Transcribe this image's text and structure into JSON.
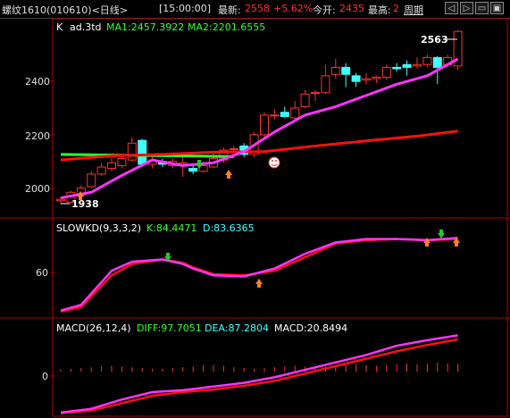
{
  "header": {
    "instrument": "螺纹1610(010610)<日线>",
    "time": "[15:00:00]",
    "latest_label": "最新:",
    "latest_value": "2558",
    "change_pct": "+5.62%",
    "open_label": "今开:",
    "open_value": "2435",
    "high_label": "最高:",
    "high_value": "2",
    "period_label": "周期",
    "buttons": [
      "◁",
      "▷",
      "▭",
      "▣"
    ]
  },
  "main_panel": {
    "label_k": "K",
    "label_ind": "ad.3td",
    "ma1_text": "MA1:2457.3922",
    "ma2_text": "MA2:2201.6555",
    "ticks": [
      "2400",
      "2200",
      "2000"
    ],
    "high_marker": "2563",
    "low_marker": "1938"
  },
  "kd_panel": {
    "name": "SLOWKD(9,3,3,2)",
    "k_text": "K:84.4471",
    "d_text": "D:83.6365",
    "ticks": [
      "60"
    ]
  },
  "macd_panel": {
    "name": "MACD(26,12,4)",
    "diff_text": "DIFF:97.7051",
    "dea_text": "DEA:87.2804",
    "macd_text": "MACD:20.8494",
    "ticks": [
      "0"
    ]
  },
  "colors": {
    "up": "#ff3030",
    "down": "#40ffff",
    "ma1": "#ff33ff",
    "ma2": "#ff1010",
    "flat_green": "#30ff30",
    "label_green": "#30ff30",
    "label_cyan": "#40ffff",
    "label_white": "#ffffff",
    "frame": "#b00000"
  },
  "chart_data": [
    {
      "type": "candlestick",
      "yticks": [
        2000,
        2200,
        2400
      ],
      "ylim": [
        1900,
        2600
      ],
      "candles": [
        {
          "o": 1955,
          "c": 1960,
          "h": 1970,
          "l": 1945
        },
        {
          "o": 1950,
          "c": 1985,
          "h": 1990,
          "l": 1945
        },
        {
          "o": 1975,
          "c": 2000,
          "h": 2010,
          "l": 1960
        },
        {
          "o": 2005,
          "c": 2050,
          "h": 2060,
          "l": 2000
        },
        {
          "o": 2050,
          "c": 2075,
          "h": 2090,
          "l": 2045
        },
        {
          "o": 2070,
          "c": 2090,
          "h": 2110,
          "l": 2060
        },
        {
          "o": 2080,
          "c": 2105,
          "h": 2120,
          "l": 2070
        },
        {
          "o": 2100,
          "c": 2160,
          "h": 2180,
          "l": 2095
        },
        {
          "o": 2170,
          "c": 2085,
          "h": 2175,
          "l": 2080
        },
        {
          "o": 2085,
          "c": 2100,
          "h": 2115,
          "l": 2070
        },
        {
          "o": 2095,
          "c": 2085,
          "h": 2105,
          "l": 2075
        },
        {
          "o": 2080,
          "c": 2095,
          "h": 2105,
          "l": 2070
        },
        {
          "o": 2085,
          "c": 2090,
          "h": 2110,
          "l": 2040
        },
        {
          "o": 2070,
          "c": 2060,
          "h": 2085,
          "l": 2050
        },
        {
          "o": 2060,
          "c": 2080,
          "h": 2095,
          "l": 2055
        },
        {
          "o": 2075,
          "c": 2105,
          "h": 2130,
          "l": 2070
        },
        {
          "o": 2100,
          "c": 2135,
          "h": 2145,
          "l": 2090
        },
        {
          "o": 2140,
          "c": 2140,
          "h": 2150,
          "l": 2130
        },
        {
          "o": 2150,
          "c": 2120,
          "h": 2160,
          "l": 2110
        },
        {
          "o": 2120,
          "c": 2190,
          "h": 2200,
          "l": 2110
        },
        {
          "o": 2190,
          "c": 2260,
          "h": 2270,
          "l": 2180
        },
        {
          "o": 2260,
          "c": 2260,
          "h": 2280,
          "l": 2245
        },
        {
          "o": 2270,
          "c": 2255,
          "h": 2290,
          "l": 2250
        },
        {
          "o": 2250,
          "c": 2285,
          "h": 2310,
          "l": 2240
        },
        {
          "o": 2290,
          "c": 2335,
          "h": 2350,
          "l": 2285
        },
        {
          "o": 2340,
          "c": 2340,
          "h": 2350,
          "l": 2310
        },
        {
          "o": 2340,
          "c": 2400,
          "h": 2440,
          "l": 2335
        },
        {
          "o": 2405,
          "c": 2430,
          "h": 2460,
          "l": 2390
        },
        {
          "o": 2430,
          "c": 2405,
          "h": 2445,
          "l": 2360
        },
        {
          "o": 2400,
          "c": 2380,
          "h": 2410,
          "l": 2360
        },
        {
          "o": 2385,
          "c": 2390,
          "h": 2410,
          "l": 2370
        },
        {
          "o": 2390,
          "c": 2395,
          "h": 2400,
          "l": 2375
        },
        {
          "o": 2395,
          "c": 2430,
          "h": 2440,
          "l": 2385
        },
        {
          "o": 2430,
          "c": 2425,
          "h": 2445,
          "l": 2415
        },
        {
          "o": 2440,
          "c": 2430,
          "h": 2455,
          "l": 2400
        },
        {
          "o": 2435,
          "c": 2440,
          "h": 2465,
          "l": 2425
        },
        {
          "o": 2440,
          "c": 2465,
          "h": 2475,
          "l": 2430
        },
        {
          "o": 2465,
          "c": 2430,
          "h": 2470,
          "l": 2370
        },
        {
          "o": 2440,
          "c": 2465,
          "h": 2475,
          "l": 2430
        },
        {
          "o": 2435,
          "c": 2558,
          "h": 2563,
          "l": 2420
        }
      ],
      "ma1_x": [
        0,
        3,
        6,
        9,
        12,
        15,
        18,
        21,
        24,
        27,
        30,
        33,
        36,
        39
      ],
      "ma1": [
        1965,
        1985,
        2045,
        2100,
        2080,
        2090,
        2130,
        2200,
        2260,
        2290,
        2330,
        2370,
        2400,
        2460
      ],
      "ma2_x": [
        0,
        5,
        10,
        15,
        20,
        25,
        30,
        35,
        39
      ],
      "ma2": [
        2100,
        2115,
        2120,
        2128,
        2130,
        2150,
        2168,
        2185,
        2203
      ]
    },
    {
      "type": "line",
      "name": "SLOWKD(9,3,3,2)",
      "yticks": [
        60
      ],
      "ylim": [
        20,
        105
      ],
      "x": [
        0,
        2,
        5,
        7,
        10,
        12,
        13,
        15,
        18,
        21,
        24,
        27,
        30,
        33,
        36,
        39
      ],
      "k": [
        25,
        30,
        60,
        68,
        70,
        66,
        62,
        56,
        55,
        62,
        75,
        85,
        88,
        88,
        87,
        89
      ],
      "d": [
        24,
        28,
        56,
        66,
        70,
        67,
        63,
        57,
        56,
        60,
        72,
        84,
        87,
        88,
        87,
        88
      ]
    },
    {
      "type": "line",
      "name": "MACD(26,12,4)",
      "yticks": [
        0
      ],
      "ylim": [
        -120,
        140
      ],
      "x": [
        0,
        3,
        6,
        9,
        12,
        15,
        18,
        21,
        24,
        27,
        30,
        33,
        36,
        39
      ],
      "diff": [
        -110,
        -100,
        -75,
        -55,
        -50,
        -40,
        -30,
        -15,
        5,
        25,
        45,
        70,
        85,
        98
      ],
      "dea": [
        -112,
        -105,
        -85,
        -65,
        -55,
        -48,
        -38,
        -25,
        -5,
        15,
        35,
        55,
        72,
        87
      ],
      "macd_bars": [
        6,
        8,
        10,
        12,
        14,
        16,
        14,
        12,
        10,
        8,
        8,
        10,
        12,
        14,
        18,
        18,
        16,
        12,
        10,
        8,
        10,
        12,
        14,
        16,
        14,
        12,
        14,
        16,
        18,
        20,
        18,
        16,
        18,
        20,
        22,
        20,
        22,
        24,
        22,
        21
      ]
    }
  ]
}
